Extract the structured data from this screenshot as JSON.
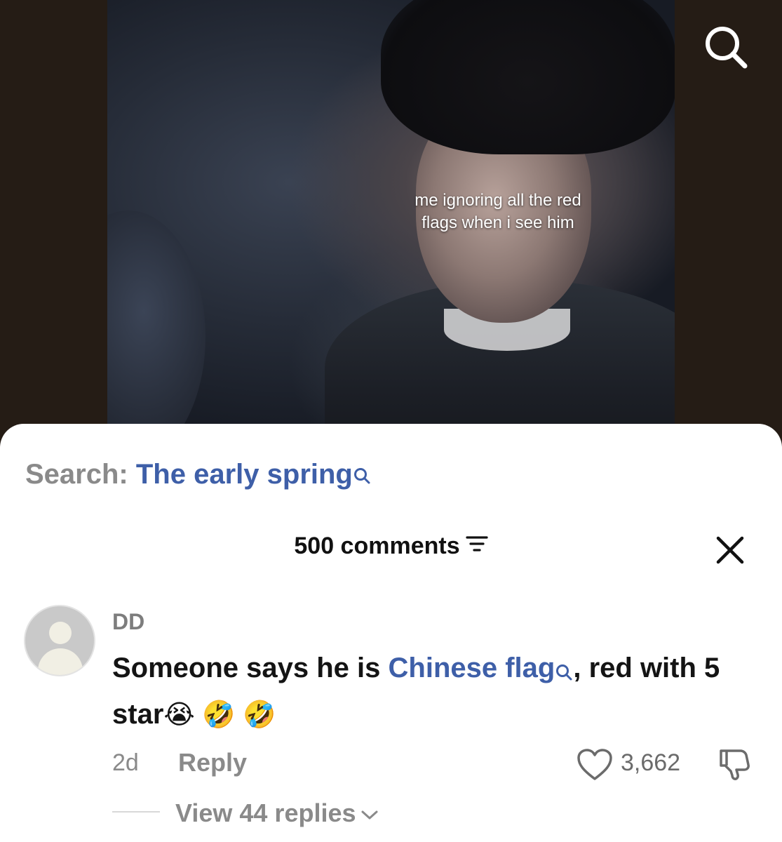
{
  "video": {
    "caption": "me ignoring all the red\nflags when i see him",
    "search_icon": "search-icon"
  },
  "sheet": {
    "search_prefix": "Search:",
    "search_term": "The early spring",
    "comments_count_label": "500 comments",
    "sort_icon": "filter-lines-icon",
    "close_icon": "close-icon"
  },
  "comment": {
    "username": "DD",
    "text_before_link": "Someone says he is ",
    "link_text": "Chinese flag",
    "text_after_link": ", red with 5 star",
    "emojis": "😭 🤣 🤣",
    "age": "2d",
    "reply_label": "Reply",
    "like_count": "3,662",
    "view_replies_label": "View 44 replies"
  },
  "colors": {
    "link": "#3e5fa8",
    "muted": "#8a8a8a",
    "video_bg": "#251c15"
  }
}
